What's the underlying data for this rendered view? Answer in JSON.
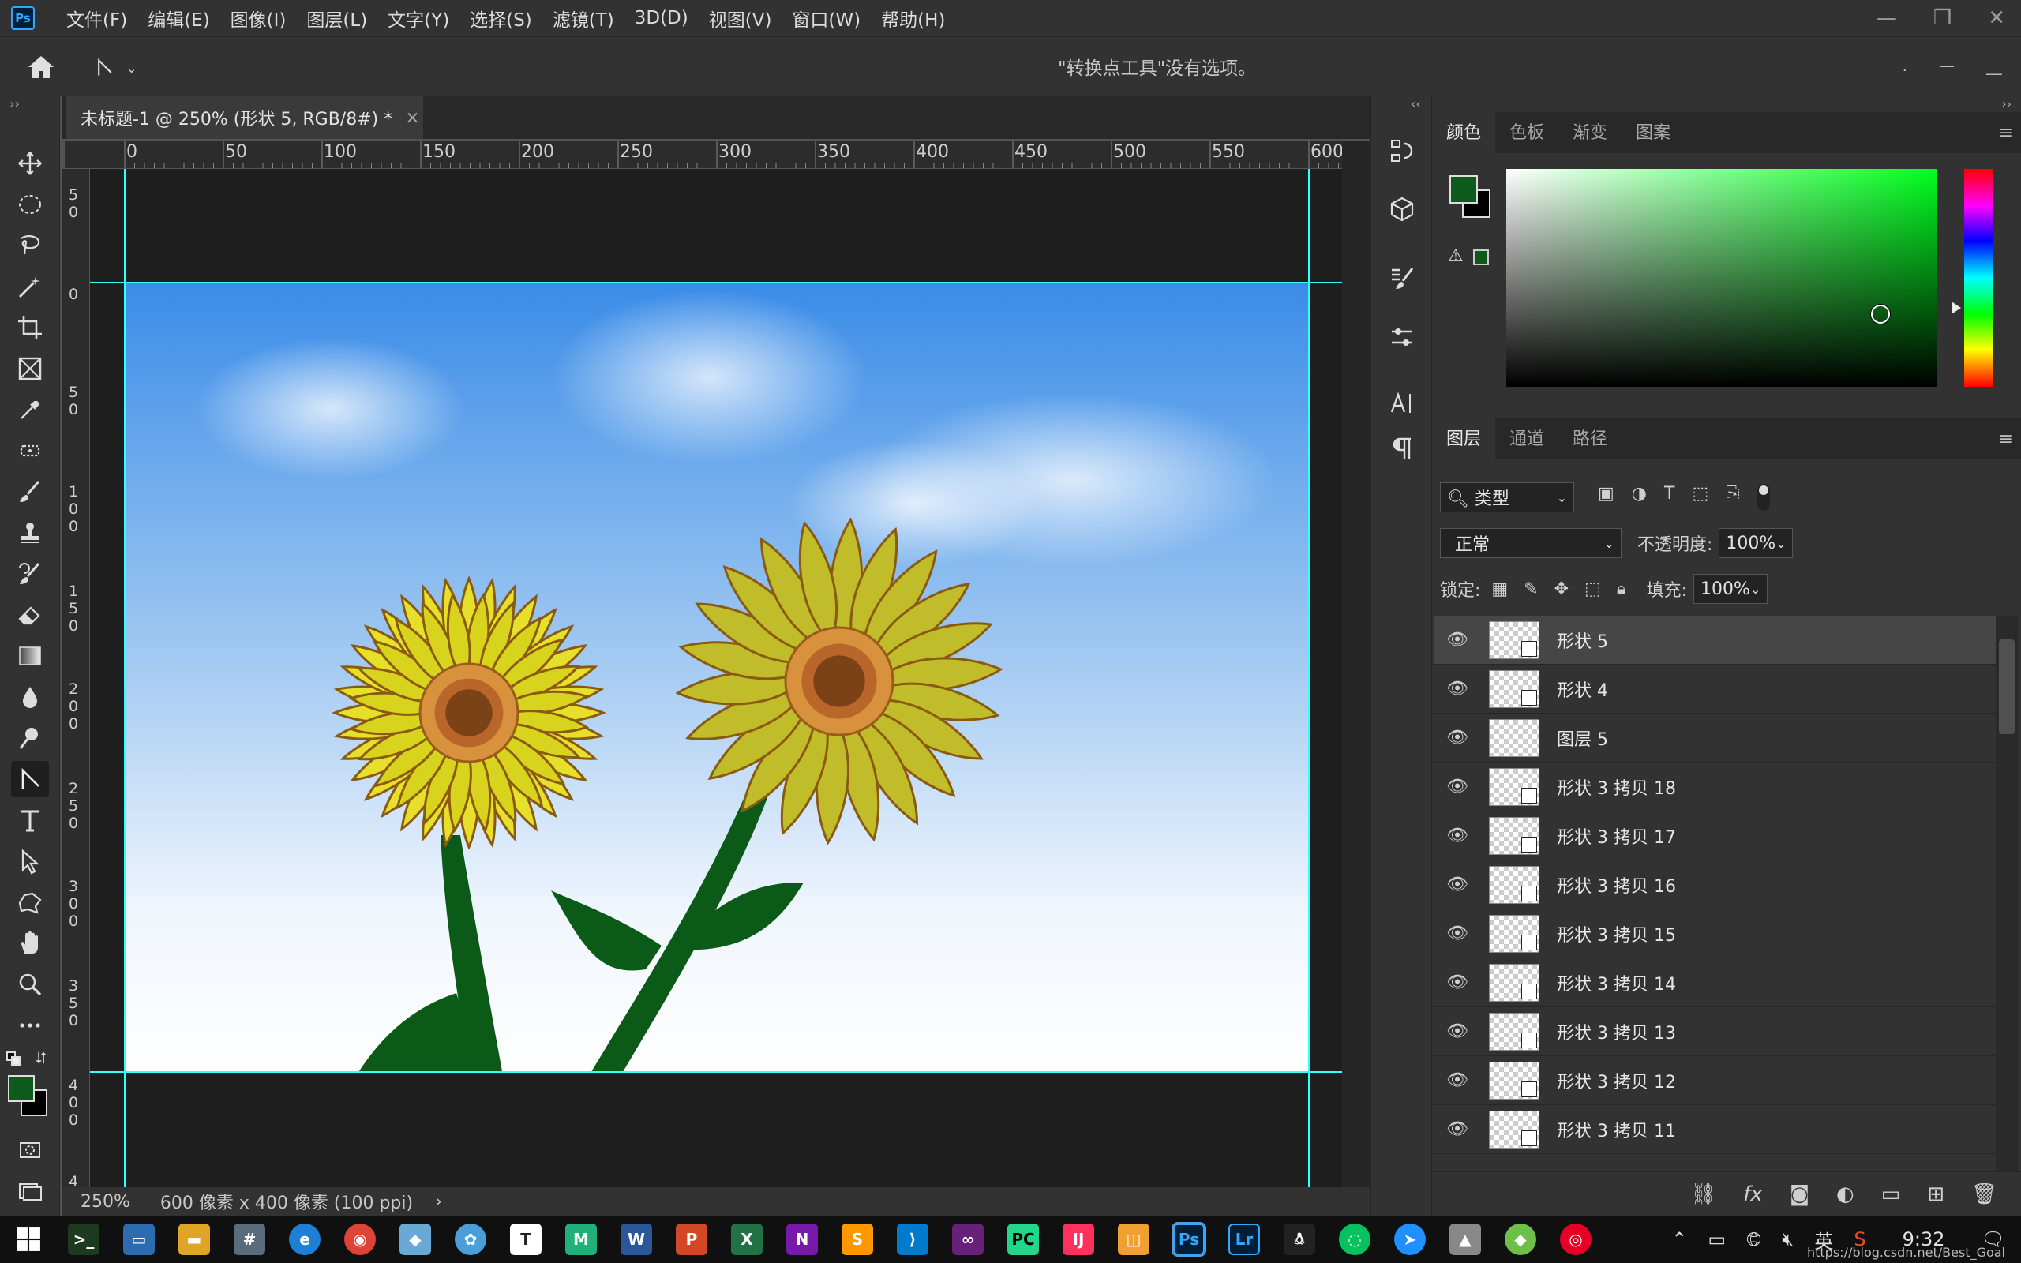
{
  "app": {
    "logo_text": "Ps"
  },
  "menu": [
    "文件(F)",
    "编辑(E)",
    "图像(I)",
    "图层(L)",
    "文字(Y)",
    "选择(S)",
    "滤镜(T)",
    "3D(D)",
    "视图(V)",
    "窗口(W)",
    "帮助(H)"
  ],
  "window_controls": [
    "—",
    "❐",
    "✕"
  ],
  "options_bar": {
    "message": "\"转换点工具\"没有选项。"
  },
  "document": {
    "tab_title": "未标题-1 @ 250% (形状 5, RGB/8#) *",
    "close_glyph": "×",
    "zoom": "250%",
    "doc_info": "600 像素 x 400 像素 (100 ppi)",
    "status_arrow": "›"
  },
  "ruler_h_labels": [
    "0",
    "50",
    "100",
    "150",
    "200",
    "250",
    "300",
    "350",
    "400",
    "450",
    "500",
    "550",
    "600"
  ],
  "ruler_v_labels": [
    "5\n0",
    "0",
    "5\n0",
    "1\n0\n0",
    "1\n5\n0",
    "2\n0\n0",
    "2\n5\n0",
    "3\n0\n0",
    "3\n5\n0",
    "4\n0\n0",
    "4"
  ],
  "color_panel": {
    "tabs": [
      "颜色",
      "色板",
      "渐变",
      "图案"
    ],
    "active_tab": 0,
    "foreground": "#0e5a1c",
    "background": "#000000"
  },
  "layers_panel": {
    "tabs": [
      "图层",
      "通道",
      "路径"
    ],
    "active_tab": 0,
    "filter_label": "类型",
    "blend_mode": "正常",
    "opacity_label": "不透明度:",
    "opacity_value": "100%",
    "lock_label": "锁定:",
    "fill_label": "填充:",
    "fill_value": "100%",
    "layers": [
      {
        "name": "形状 5",
        "selected": true,
        "type": "shape"
      },
      {
        "name": "形状 4",
        "selected": false,
        "type": "shape"
      },
      {
        "name": "图层 5",
        "selected": false,
        "type": "pixel"
      },
      {
        "name": "形状 3 拷贝 18",
        "selected": false,
        "type": "shape"
      },
      {
        "name": "形状 3 拷贝 17",
        "selected": false,
        "type": "shape"
      },
      {
        "name": "形状 3 拷贝 16",
        "selected": false,
        "type": "shape"
      },
      {
        "name": "形状 3 拷贝 15",
        "selected": false,
        "type": "shape"
      },
      {
        "name": "形状 3 拷贝 14",
        "selected": false,
        "type": "shape"
      },
      {
        "name": "形状 3 拷贝 13",
        "selected": false,
        "type": "shape"
      },
      {
        "name": "形状 3 拷贝 12",
        "selected": false,
        "type": "shape"
      },
      {
        "name": "形状 3 拷贝 11",
        "selected": false,
        "type": "shape"
      }
    ]
  },
  "taskbar": {
    "time": "9:32",
    "ime": "英",
    "watermark": "https://blog.csdn.net/Best_Goal"
  }
}
